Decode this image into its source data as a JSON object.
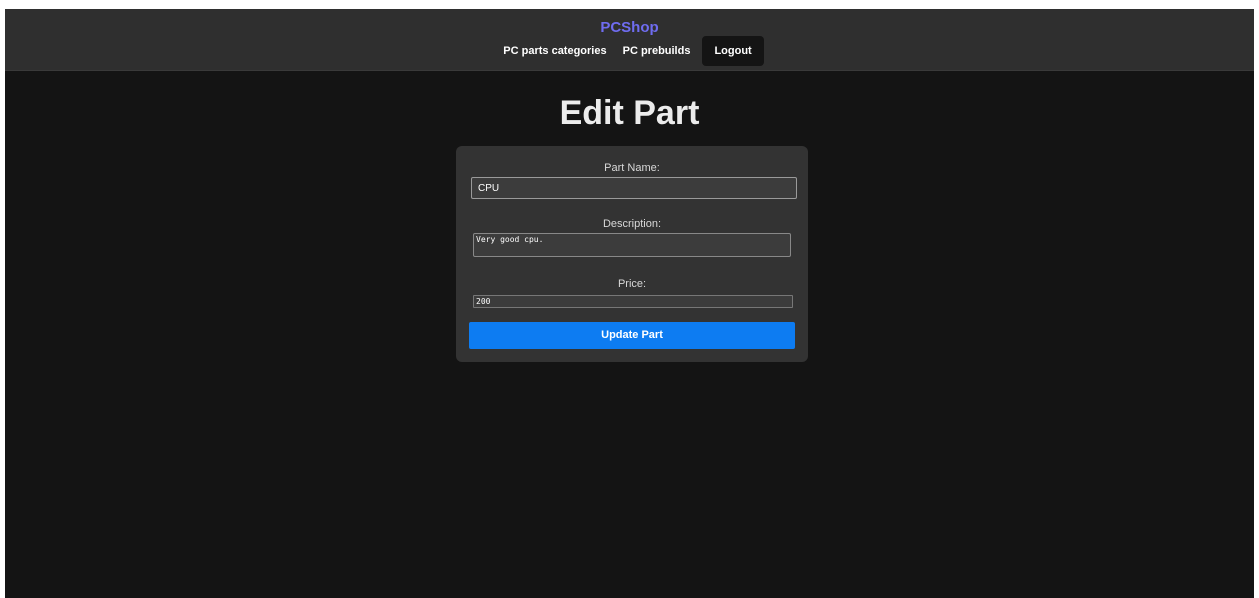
{
  "header": {
    "brand": "PCShop",
    "nav": {
      "categories": "PC parts categories",
      "prebuilds": "PC prebuilds",
      "logout": "Logout"
    }
  },
  "page": {
    "title": "Edit Part"
  },
  "form": {
    "name_label": "Part Name:",
    "name_value": "CPU",
    "description_label": "Description:",
    "description_value": "Very good cpu.",
    "price_label": "Price:",
    "price_value": "200",
    "submit_label": "Update Part"
  },
  "colors": {
    "brand": "#6f6cf0",
    "accent": "#0d7cf2",
    "background": "#141414",
    "header": "#2f2f2f",
    "card": "#333333"
  }
}
